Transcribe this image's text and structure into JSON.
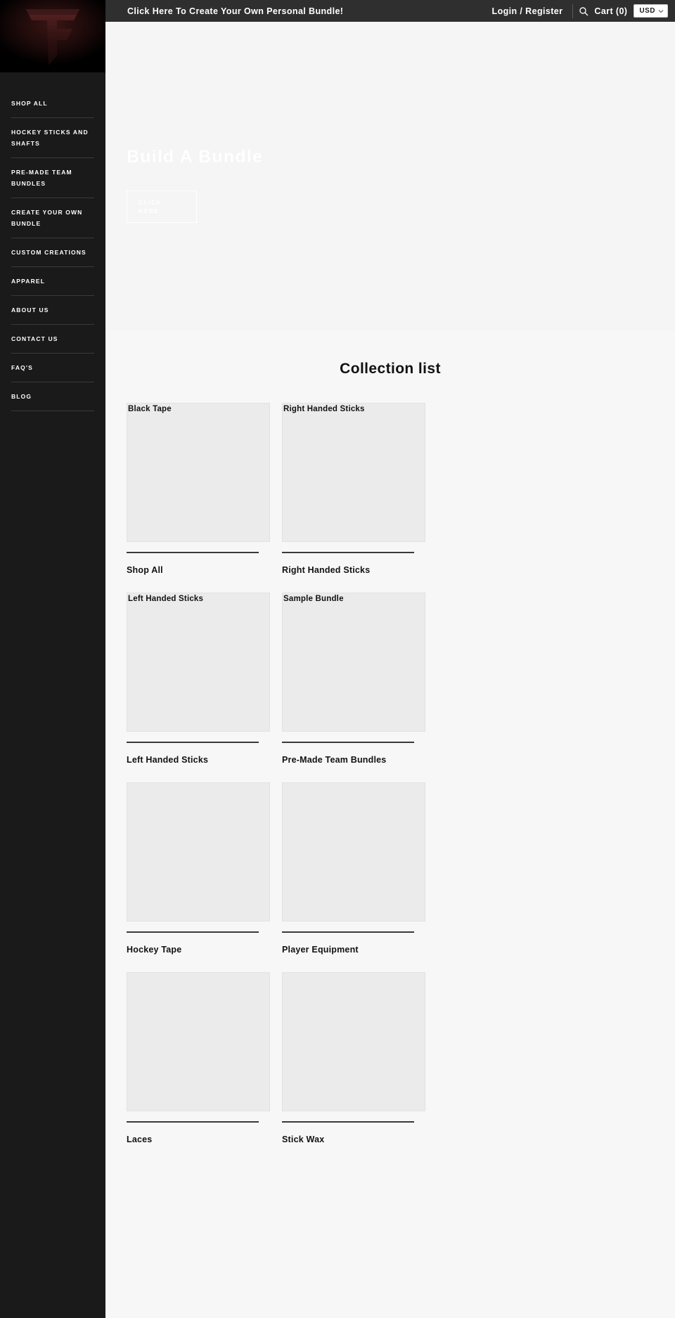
{
  "topbar": {
    "promo_text": "Click Here To Create Your Own Personal Bundle!",
    "login_label": "Login / Register",
    "search_icon": "search-icon",
    "cart_label": "Cart (0)",
    "currency_label": "USD",
    "currency_caret_icon": "chevron-down-icon",
    "background_color": "#2f2f2f"
  },
  "sidebar": {
    "logo_icon": "brand-f-logo",
    "background_color": "#1a1a1a",
    "items": [
      {
        "label": "Shop All"
      },
      {
        "label": "Hockey Sticks And Shafts"
      },
      {
        "label": "Pre-Made Team Bundles"
      },
      {
        "label": "Create Your Own Bundle"
      },
      {
        "label": "Custom Creations"
      },
      {
        "label": "Apparel"
      },
      {
        "label": "About Us"
      },
      {
        "label": "Contact Us"
      },
      {
        "label": "FAQ's"
      },
      {
        "label": "Blog"
      }
    ]
  },
  "hero": {
    "title": "Build A Bundle",
    "button_line1": "Click",
    "button_line2": "Here"
  },
  "collection_section": {
    "heading": "Collection list",
    "cards": [
      {
        "alt_text": "Black Tape",
        "title": "Shop All"
      },
      {
        "alt_text": "Right Handed Sticks",
        "title": "Right Handed Sticks"
      },
      {
        "alt_text": "Left Handed Sticks",
        "title": "Left Handed Sticks"
      },
      {
        "alt_text": "Sample Bundle",
        "title": "Pre-Made Team Bundles"
      },
      {
        "alt_text": "",
        "title": "Hockey Tape"
      },
      {
        "alt_text": "",
        "title": "Player Equipment"
      },
      {
        "alt_text": "",
        "title": "Laces"
      },
      {
        "alt_text": "",
        "title": "Stick Wax"
      }
    ]
  }
}
